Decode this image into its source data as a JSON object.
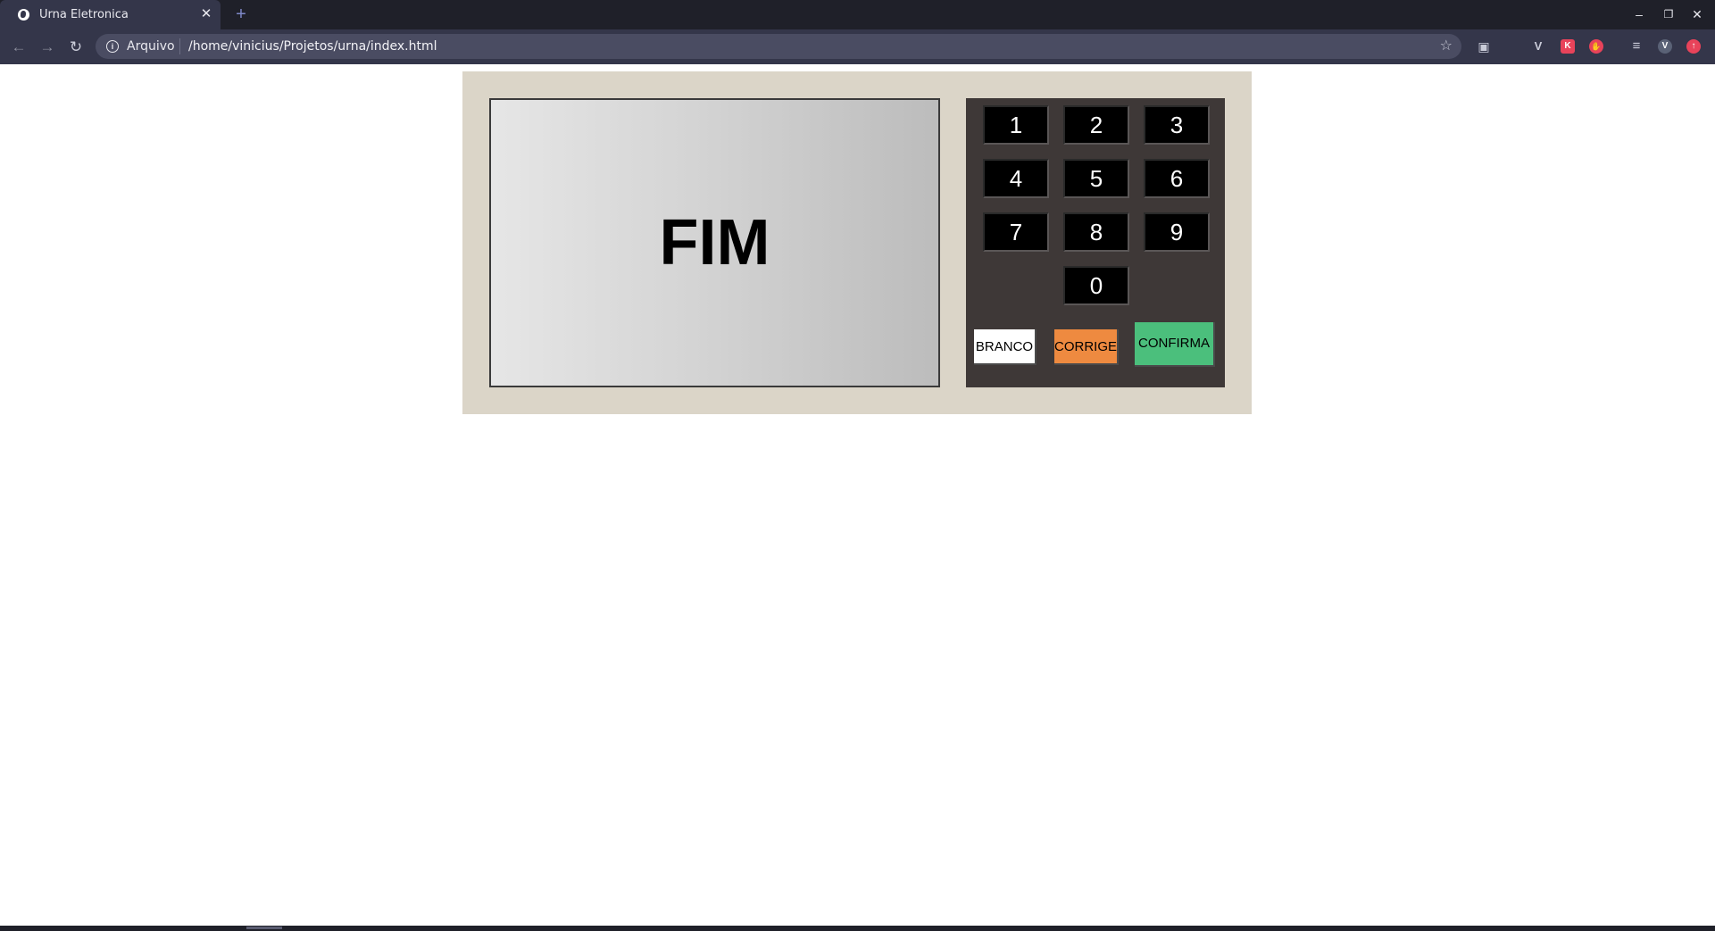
{
  "browser": {
    "tab_title": "Urna Eletronica",
    "tab_close": "✕",
    "new_tab": "+",
    "scheme_label": "Arquivo",
    "url": "/home/vinicius/Projetos/urna/index.html",
    "window_controls": {
      "minimize": "–",
      "restore": "❐",
      "close": "✕"
    },
    "avatar_initial": "V",
    "extensions": [
      {
        "name": "v-extension-icon",
        "color": "#34364a",
        "glyph": "V"
      },
      {
        "name": "k-extension-icon",
        "color": "#e8435a",
        "glyph": "K"
      },
      {
        "name": "hand-extension-icon",
        "color": "#e8435a",
        "glyph": "✋"
      },
      {
        "name": "upload-extension-icon",
        "color": "#e8435a",
        "glyph": "↑"
      }
    ]
  },
  "urna": {
    "screen_message": "FIM",
    "keys": {
      "k1": "1",
      "k2": "2",
      "k3": "3",
      "k4": "4",
      "k5": "5",
      "k6": "6",
      "k7": "7",
      "k8": "8",
      "k9": "9",
      "k0": "0"
    },
    "actions": {
      "branco": "BRANCO",
      "corrige": "CORRIGE",
      "confirma": "CONFIRMA"
    },
    "colors": {
      "cabinet": "#dbd5c8",
      "keypad": "#3e3837",
      "branco": "#ffffff",
      "corrige": "#ee8a40",
      "confirma": "#4bbf7c"
    }
  }
}
